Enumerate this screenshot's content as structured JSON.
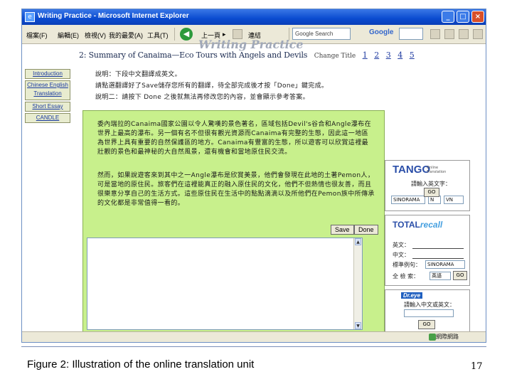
{
  "window": {
    "title": "Writing Practice - Microsoft Internet Explorer"
  },
  "menubar": {
    "items": [
      "檔案(F)",
      "編輯(E)",
      "檢視(V)",
      "我的最愛(A)",
      "工具(T)"
    ],
    "back_label": "上一頁",
    "links_label": "連結",
    "search_value": "Google Search",
    "google_label": "Google"
  },
  "page": {
    "heading": "Writing Practice",
    "summary": "2: Summary of Canaima—Eco Tours with Angels and Devils",
    "change_title": "Change Title",
    "pages": [
      "1",
      "2",
      "3",
      "4",
      "5"
    ],
    "nav": [
      "Introduction",
      "Chinese English Translation",
      "Short Essay",
      "CANDLE"
    ],
    "instructions": [
      "說明：下段中文翻譯成英文。",
      "請點選翻譯好了Save儲存您所有的翻譯，待全部完成後才按「Done」鍵完成。",
      "說明二：請按下 Done 之後就無法再修改您的內容，並會顯示參考答案。"
    ],
    "paragraphs": [
      "委內瑞拉的Canaima國家公園以令人驚嘆的景色著名，區域包括Devil's谷合和Angle瀑布在世界上最高的瀑布。另一個有名不但很有觀光資源而Canaima有完整的生態，因此這一地區為世界上具有重要的自然保護區的地方。Canaima有豐富的生態，所以遊客可以欣賞這裡最壯觀的景色和最神秘的大自然風景，還有機會和當地原住民交流。",
      "然而，如果說遊客來到其中之一Angle瀑布是欣賞美景，他們會發現在此地的土著Pemon人，可是當地的原住民。旅客們在這裡能真正的融入原住民的文化，他們不但熱情也很友善，而且很樂意分享自己的生活方式。這些原住民在生活中的點點滴滴以及所他們在Pemon族中所傳承的文化都是非常值得一看的。"
    ],
    "save_label": "Save",
    "done_label": "Done"
  },
  "tools": {
    "tango": {
      "brand": "TANGO",
      "sub": "Online Translation",
      "prompt": "請輸入英文字：",
      "selects": [
        "SINORAMA",
        "N",
        "VN"
      ],
      "go": "GO"
    },
    "totalrecall": {
      "brand_a": "TOTAL",
      "brand_b": "recall",
      "fields": [
        "英文：",
        "中文：",
        "標準例句："
      ],
      "source_value": "SINORAMA",
      "search_label": "全 檢 索：",
      "lang_value": "英語",
      "go": "GO"
    },
    "dreye": {
      "brand": "Dr.eye",
      "prompt": "請輸入中文或英文：",
      "go": "GO"
    }
  },
  "statusbar": {
    "text": "網際網路"
  },
  "caption": "Figure 2: Illustration of the online translation unit",
  "page_number": "17"
}
